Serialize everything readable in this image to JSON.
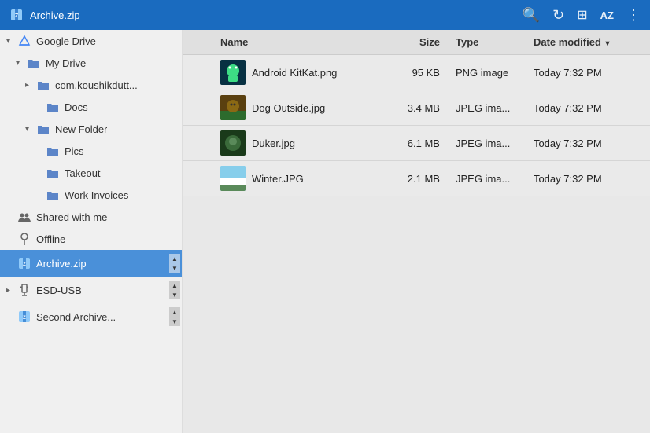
{
  "titlebar": {
    "title": "Archive.zip",
    "icon": "📦",
    "actions": {
      "search": "🔍",
      "refresh": "↻",
      "grid": "⊞",
      "sort": "AZ",
      "more": "⋮"
    }
  },
  "sidebar": {
    "items": [
      {
        "id": "google-drive",
        "label": "Google Drive",
        "icon": "gdrive",
        "indent": 0,
        "expand": "▾",
        "active": false
      },
      {
        "id": "my-drive",
        "label": "My Drive",
        "icon": "folder",
        "indent": 1,
        "expand": "▾",
        "active": false
      },
      {
        "id": "com-koushik",
        "label": "com.koushikdutt...",
        "icon": "folder",
        "indent": 2,
        "expand": "▸",
        "active": false
      },
      {
        "id": "docs",
        "label": "Docs",
        "icon": "folder",
        "indent": 3,
        "expand": "",
        "active": false
      },
      {
        "id": "new-folder",
        "label": "New Folder",
        "icon": "folder",
        "indent": 2,
        "expand": "▾",
        "active": false
      },
      {
        "id": "pics",
        "label": "Pics",
        "icon": "folder",
        "indent": 3,
        "expand": "",
        "active": false
      },
      {
        "id": "takeout",
        "label": "Takeout",
        "icon": "folder",
        "indent": 3,
        "expand": "",
        "active": false
      },
      {
        "id": "work-invoices",
        "label": "Work Invoices",
        "icon": "folder",
        "indent": 3,
        "expand": "",
        "active": false
      },
      {
        "id": "shared-with-me",
        "label": "Shared with me",
        "icon": "people",
        "indent": 0,
        "expand": "",
        "active": false
      },
      {
        "id": "offline",
        "label": "Offline",
        "icon": "pin",
        "indent": 0,
        "expand": "",
        "active": false
      },
      {
        "id": "archive-zip",
        "label": "Archive.zip",
        "icon": "zip",
        "indent": 0,
        "expand": "",
        "active": true,
        "scrollbar": true
      },
      {
        "id": "esd-usb",
        "label": "ESD-USB",
        "icon": "usb",
        "indent": 0,
        "expand": "▸",
        "active": false,
        "scrollbar": true
      },
      {
        "id": "second-archive",
        "label": "Second Archive...",
        "icon": "zip",
        "indent": 0,
        "expand": "",
        "active": false,
        "scrollbar": true
      }
    ]
  },
  "content": {
    "columns": [
      {
        "id": "name",
        "label": "Name",
        "sortable": true,
        "sort_direction": ""
      },
      {
        "id": "size",
        "label": "Size",
        "sortable": true,
        "sort_direction": ""
      },
      {
        "id": "type",
        "label": "Type",
        "sortable": true,
        "sort_direction": ""
      },
      {
        "id": "date",
        "label": "Date modified",
        "sortable": true,
        "sort_direction": "▾"
      }
    ],
    "files": [
      {
        "name": "Android KitKat.png",
        "thumb": "android",
        "size": "95 KB",
        "type": "PNG image",
        "date": "Today 7:32 PM"
      },
      {
        "name": "Dog Outside.jpg",
        "thumb": "dog",
        "size": "3.4 MB",
        "type": "JPEG ima...",
        "date": "Today 7:32 PM"
      },
      {
        "name": "Duker.jpg",
        "thumb": "duker",
        "size": "6.1 MB",
        "type": "JPEG ima...",
        "date": "Today 7:32 PM"
      },
      {
        "name": "Winter.JPG",
        "thumb": "winter",
        "size": "2.1 MB",
        "type": "JPEG ima...",
        "date": "Today 7:32 PM"
      }
    ]
  }
}
